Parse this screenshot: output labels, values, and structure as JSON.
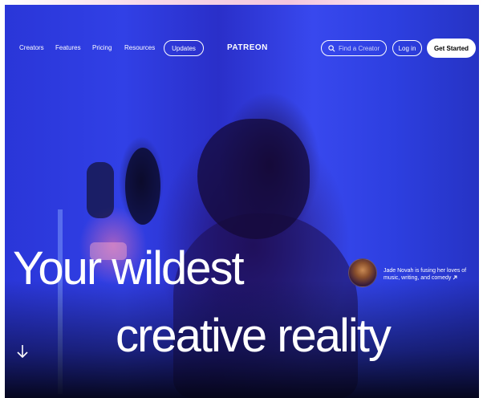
{
  "nav": {
    "links": [
      "Creators",
      "Features",
      "Pricing",
      "Resources"
    ],
    "updates_label": "Updates",
    "brand": "PATREON",
    "search_placeholder": "Find a Creator",
    "login_label": "Log in",
    "cta_label": "Get Started"
  },
  "hero": {
    "headline_line1": "Your wildest",
    "headline_line2": "creative reality",
    "creator_caption": "Jade Novah is fusing her loves of music, writing, and comedy"
  },
  "icons": {
    "search": "search-icon",
    "scroll": "arrow-down-icon",
    "caption_arrow": "arrow-up-right-icon"
  },
  "colors": {
    "hero_blue": "#3140e6",
    "cta_bg": "#ffffff",
    "text": "#ffffff"
  }
}
